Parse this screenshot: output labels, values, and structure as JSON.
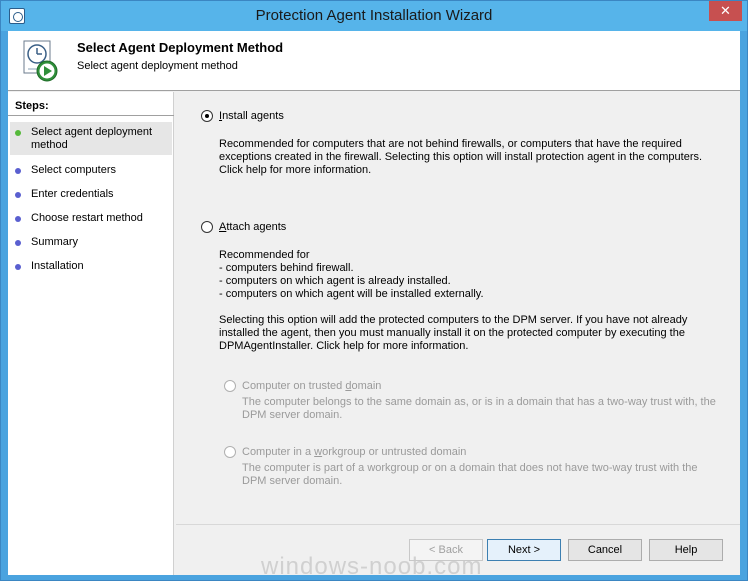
{
  "window": {
    "title": "Protection Agent Installation Wizard",
    "close_label": "✕"
  },
  "header": {
    "title": "Select Agent Deployment Method",
    "subtitle": "Select agent deployment method"
  },
  "sidebar": {
    "steps_label": "Steps:",
    "steps": [
      {
        "label": "Select agent deployment method",
        "active": true
      },
      {
        "label": "Select computers",
        "active": false
      },
      {
        "label": "Enter credentials",
        "active": false
      },
      {
        "label": "Choose restart method",
        "active": false
      },
      {
        "label": "Summary",
        "active": false
      },
      {
        "label": "Installation",
        "active": false
      }
    ]
  },
  "content": {
    "install_agents": {
      "label_underlined": "I",
      "label_rest": "nstall agents",
      "checked": true,
      "description": "Recommended for computers that are not behind firewalls, or computers that have the required exceptions created in the firewall. Selecting this option will install protection agent in the computers. Click help for more information."
    },
    "attach_agents": {
      "label_underlined": "A",
      "label_rest": "ttach agents",
      "checked": false,
      "recommended_intro": "Recommended for",
      "bullets": [
        "- computers behind firewall.",
        "- computers on which agent is already installed.",
        "- computers on which agent will be installed externally."
      ],
      "description": "Selecting this option will add the protected computers to the DPM server. If you have not already installed the agent, then you must manually install it on the protected computer by executing the DPMAgentInstaller. Click help for more information."
    },
    "trusted_domain": {
      "label_pre": "Computer on trusted ",
      "label_underlined": "d",
      "label_post": "omain",
      "description": "The computer belongs to the same domain as, or is in a domain that has a two-way trust with, the DPM server domain."
    },
    "workgroup": {
      "label_pre": "Computer in a ",
      "label_underlined": "w",
      "label_post": "orkgroup or untrusted domain",
      "description": "The computer is part of a workgroup or on a domain that does not have two-way trust with the DPM server domain."
    }
  },
  "buttons": {
    "back": "< Back",
    "next": "Next >",
    "cancel": "Cancel",
    "help": "Help"
  },
  "watermark": "windows-noob.com",
  "colors": {
    "titlebar": "#56b4ea",
    "close": "#c75050",
    "active_step_dot": "#55b93a",
    "step_dot": "#5a5fd0"
  }
}
